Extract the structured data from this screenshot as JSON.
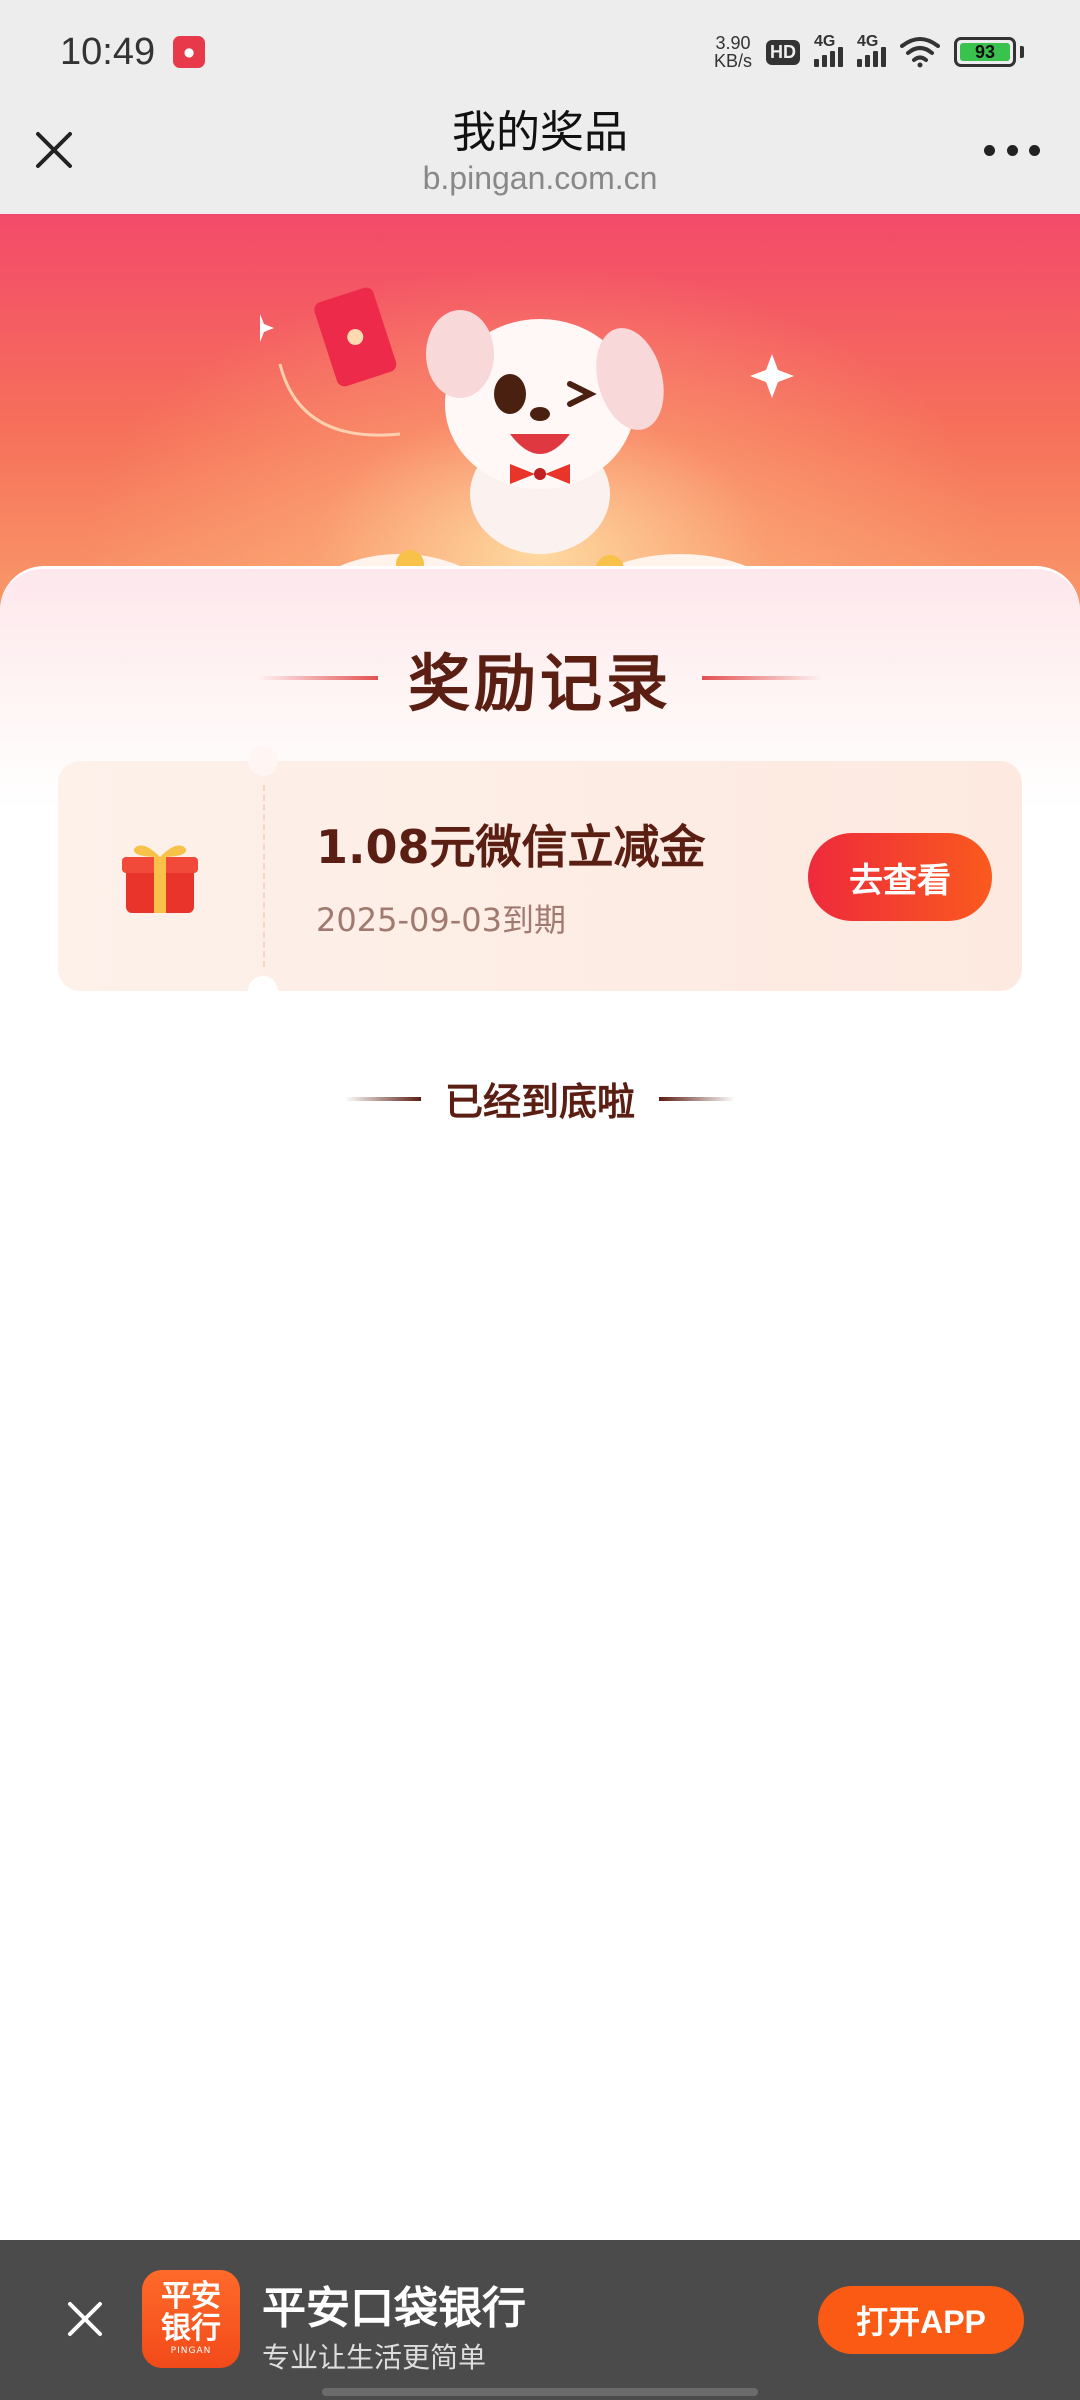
{
  "status_bar": {
    "time": "10:49",
    "net_speed_value": "3.90",
    "net_speed_unit": "KB/s",
    "hd_label": "HD",
    "signal1_label": "4G",
    "signal2_label": "4G",
    "battery": "93",
    "battery_color": "#3ac24e"
  },
  "nav": {
    "title": "我的奖品",
    "subtitle": "b.pingan.com.cn"
  },
  "section": {
    "title": "奖励记录"
  },
  "rewards": [
    {
      "name": "1.08元微信立减金",
      "expiry": "2025-09-03到期",
      "button": "去查看"
    }
  ],
  "end_text": "已经到底啦",
  "app_banner": {
    "logo_line1": "平安",
    "logo_line2": "银行",
    "logo_sub": "PINGAN",
    "name": "平安口袋银行",
    "slogan": "专业让生活更简单",
    "button": "打开APP"
  },
  "colors": {
    "accent": "#fa5a14",
    "title_brown": "#5a1e12",
    "banner_top": "#f34a6a"
  }
}
